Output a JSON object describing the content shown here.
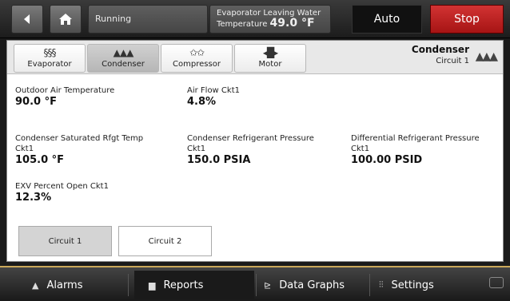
{
  "header": {
    "status": "Running",
    "evap_label_1": "Evaporator Leaving Water",
    "evap_label_2": "Temperature",
    "evap_value": "49.0 °F",
    "auto_label": "Auto",
    "stop_label": "Stop"
  },
  "tabs": [
    {
      "label": "Evaporator",
      "icon": "evaporator-icon"
    },
    {
      "label": "Condenser",
      "icon": "condenser-icon"
    },
    {
      "label": "Compressor",
      "icon": "compressor-icon"
    },
    {
      "label": "Motor",
      "icon": "motor-icon"
    }
  ],
  "section": {
    "title": "Condenser",
    "subtitle": "Circuit 1"
  },
  "fields": {
    "outdoor_temp": {
      "label": "Outdoor Air Temperature",
      "value": "90.0 °F"
    },
    "air_flow": {
      "label": "Air Flow Ckt1",
      "value": "4.8%"
    },
    "cond_sat_temp": {
      "label1": "Condenser Saturated Rfgt Temp",
      "label2": "Ckt1",
      "value": "105.0 °F"
    },
    "cond_pressure": {
      "label1": "Condenser Refrigerant Pressure",
      "label2": "Ckt1",
      "value": "150.0 PSIA"
    },
    "diff_pressure": {
      "label1": "Differential Refrigerant Pressure",
      "label2": "Ckt1",
      "value": "100.00 PSID"
    },
    "exv": {
      "label": "EXV Percent Open Ckt1",
      "value": "12.3%"
    }
  },
  "circuits": [
    "Circuit 1",
    "Circuit 2"
  ],
  "nav": {
    "alarms": "Alarms",
    "reports": "Reports",
    "graphs": "Data Graphs",
    "settings": "Settings"
  },
  "colors": {
    "stop": "#c01f1f",
    "accent_line": "#caa85a"
  }
}
